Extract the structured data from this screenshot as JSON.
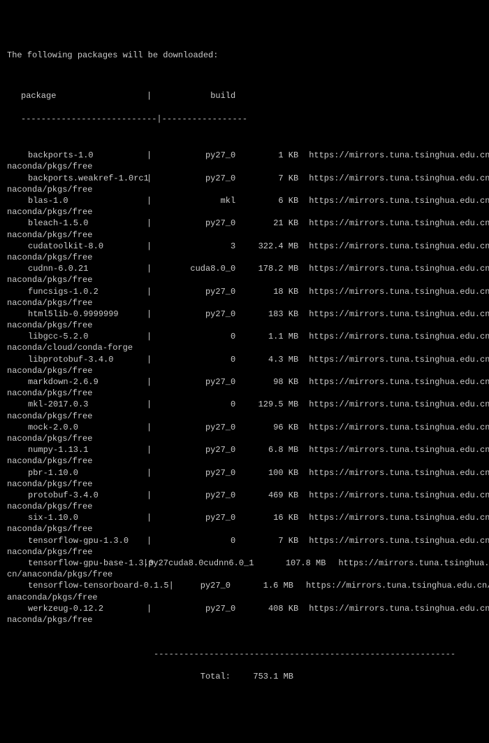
{
  "header": "The following packages will be downloaded:",
  "columns": {
    "package": "package",
    "build": "build"
  },
  "divider_main": "---------------------------|-----------------",
  "divider_total": "------------------------------------------------------------",
  "packages": [
    {
      "name": "backports-1.0",
      "build": "py27_0",
      "size": "1 KB",
      "url": "https://mirrors.tuna.tsinghua.edu.cn/a",
      "urlline": "naconda/pkgs/free"
    },
    {
      "name": "backports.weakref-1.0rc1",
      "build": "py27_0",
      "size": "7 KB",
      "url": "https://mirrors.tuna.tsinghua.edu.cn/a",
      "urlline": "naconda/pkgs/free"
    },
    {
      "name": "blas-1.0",
      "build": "mkl",
      "size": "6 KB",
      "url": "https://mirrors.tuna.tsinghua.edu.cn/a",
      "urlline": "naconda/pkgs/free"
    },
    {
      "name": "bleach-1.5.0",
      "build": "py27_0",
      "size": "21 KB",
      "url": "https://mirrors.tuna.tsinghua.edu.cn/a",
      "urlline": "naconda/pkgs/free"
    },
    {
      "name": "cudatoolkit-8.0",
      "build": "3",
      "size": "322.4 MB",
      "url": "https://mirrors.tuna.tsinghua.edu.cn/a",
      "urlline": "naconda/pkgs/free"
    },
    {
      "name": "cudnn-6.0.21",
      "build": "cuda8.0_0",
      "size": "178.2 MB",
      "url": "https://mirrors.tuna.tsinghua.edu.cn/a",
      "urlline": "naconda/pkgs/free"
    },
    {
      "name": "funcsigs-1.0.2",
      "build": "py27_0",
      "size": "18 KB",
      "url": "https://mirrors.tuna.tsinghua.edu.cn/a",
      "urlline": "naconda/pkgs/free"
    },
    {
      "name": "html5lib-0.9999999",
      "build": "py27_0",
      "size": "183 KB",
      "url": "https://mirrors.tuna.tsinghua.edu.cn/a",
      "urlline": "naconda/pkgs/free"
    },
    {
      "name": "libgcc-5.2.0",
      "build": "0",
      "size": "1.1 MB",
      "url": "https://mirrors.tuna.tsinghua.edu.cn/a",
      "urlline": "naconda/cloud/conda-forge"
    },
    {
      "name": "libprotobuf-3.4.0",
      "build": "0",
      "size": "4.3 MB",
      "url": "https://mirrors.tuna.tsinghua.edu.cn/a",
      "urlline": "naconda/pkgs/free"
    },
    {
      "name": "markdown-2.6.9",
      "build": "py27_0",
      "size": "98 KB",
      "url": "https://mirrors.tuna.tsinghua.edu.cn/a",
      "urlline": "naconda/pkgs/free"
    },
    {
      "name": "mkl-2017.0.3",
      "build": "0",
      "size": "129.5 MB",
      "url": "https://mirrors.tuna.tsinghua.edu.cn/a",
      "urlline": "naconda/pkgs/free"
    },
    {
      "name": "mock-2.0.0",
      "build": "py27_0",
      "size": "96 KB",
      "url": "https://mirrors.tuna.tsinghua.edu.cn/a",
      "urlline": "naconda/pkgs/free"
    },
    {
      "name": "numpy-1.13.1",
      "build": "py27_0",
      "size": "6.8 MB",
      "url": "https://mirrors.tuna.tsinghua.edu.cn/a",
      "urlline": "naconda/pkgs/free"
    },
    {
      "name": "pbr-1.10.0",
      "build": "py27_0",
      "size": "100 KB",
      "url": "https://mirrors.tuna.tsinghua.edu.cn/a",
      "urlline": "naconda/pkgs/free"
    },
    {
      "name": "protobuf-3.4.0",
      "build": "py27_0",
      "size": "469 KB",
      "url": "https://mirrors.tuna.tsinghua.edu.cn/a",
      "urlline": "naconda/pkgs/free"
    },
    {
      "name": "six-1.10.0",
      "build": "py27_0",
      "size": "16 KB",
      "url": "https://mirrors.tuna.tsinghua.edu.cn/a",
      "urlline": "naconda/pkgs/free"
    },
    {
      "name": "tensorflow-gpu-1.3.0",
      "build": "0",
      "size": "7 KB",
      "url": "https://mirrors.tuna.tsinghua.edu.cn/a",
      "urlline": "naconda/pkgs/free"
    }
  ],
  "special_packages": [
    {
      "name": "tensorflow-gpu-base-1.3.0",
      "buildline": "|py27cuda8.0cudnn6.0_1",
      "size": "107.8 MB",
      "url": "https://mirrors.tuna.tsinghua.edu.",
      "urlline": "cn/anaconda/pkgs/free"
    },
    {
      "name": "tensorflow-tensorboard-0.1.5|",
      "build": "py27_0",
      "size": "1.6 MB",
      "url": "https://mirrors.tuna.tsinghua.edu.cn/",
      "urlline": "anaconda/pkgs/free"
    }
  ],
  "last_package": {
    "name": "werkzeug-0.12.2",
    "build": "py27_0",
    "size": "408 KB",
    "url": "https://mirrors.tuna.tsinghua.edu.cn/a",
    "urlline": "naconda/pkgs/free"
  },
  "total": {
    "label": "Total:",
    "value": "753.1 MB"
  }
}
